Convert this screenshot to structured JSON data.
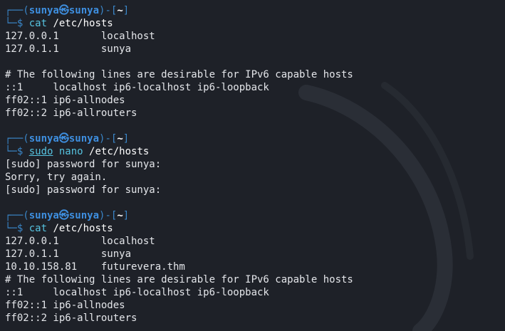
{
  "prompts": [
    {
      "user": "sunya",
      "at": "㉿",
      "host": "sunya",
      "cwd": "~",
      "command": "cat",
      "args": "/etc/hosts"
    },
    {
      "user": "sunya",
      "at": "㉿",
      "host": "sunya",
      "cwd": "~",
      "command_prefix": "sudo",
      "command": "nano",
      "args": "/etc/hosts"
    },
    {
      "user": "sunya",
      "at": "㉿",
      "host": "sunya",
      "cwd": "~",
      "command": "cat",
      "args": "/etc/hosts"
    }
  ],
  "output1": [
    "127.0.0.1       localhost",
    "127.0.1.1       sunya",
    "",
    "# The following lines are desirable for IPv6 capable hosts",
    "::1     localhost ip6-localhost ip6-loopback",
    "ff02::1 ip6-allnodes",
    "ff02::2 ip6-allrouters"
  ],
  "output2": [
    "[sudo] password for sunya:",
    "Sorry, try again.",
    "[sudo] password for sunya:"
  ],
  "output3": [
    "127.0.0.1       localhost",
    "127.0.1.1       sunya",
    "10.10.158.81    futurevera.thm",
    "# The following lines are desirable for IPv6 capable hosts",
    "::1     localhost ip6-localhost ip6-loopback",
    "ff02::1 ip6-allnodes",
    "ff02::2 ip6-allrouters"
  ],
  "colors": {
    "background": "#1e2128",
    "prompt_box": "#3a86c8",
    "user_host": "#3e8fe0",
    "command": "#56c3e0",
    "text": "#e4e6ea"
  }
}
